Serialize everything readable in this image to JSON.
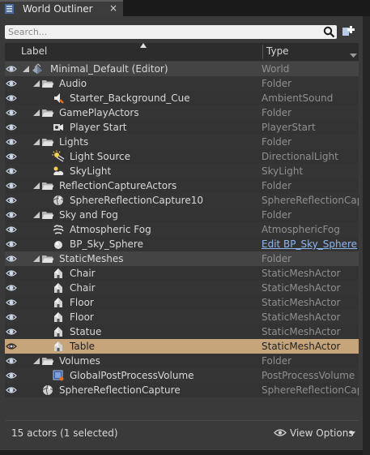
{
  "tab": {
    "title": "World Outliner",
    "close_label": "×"
  },
  "search": {
    "placeholder": "Search...",
    "value": ""
  },
  "columns": {
    "label": "Label",
    "type": "Type"
  },
  "rows": [
    {
      "label": "Minimal_Default (Editor)",
      "type": "World",
      "depth": 0,
      "icon": "world-icon",
      "expanded": true
    },
    {
      "label": "Audio",
      "type": "Folder",
      "depth": 1,
      "icon": "folder-open-icon",
      "expanded": true
    },
    {
      "label": "Starter_Background_Cue",
      "type": "AmbientSound",
      "depth": 2,
      "icon": "ambient-sound-icon"
    },
    {
      "label": "GamePlayActors",
      "type": "Folder",
      "depth": 1,
      "icon": "folder-open-icon",
      "expanded": true
    },
    {
      "label": "Player Start",
      "type": "PlayerStart",
      "depth": 2,
      "icon": "player-start-icon"
    },
    {
      "label": "Lights",
      "type": "Folder",
      "depth": 1,
      "icon": "folder-open-icon",
      "expanded": true
    },
    {
      "label": "Light Source",
      "type": "DirectionalLight",
      "depth": 2,
      "icon": "directional-light-icon"
    },
    {
      "label": "SkyLight",
      "type": "SkyLight",
      "depth": 2,
      "icon": "skylight-icon"
    },
    {
      "label": "ReflectionCaptureActors",
      "type": "Folder",
      "depth": 1,
      "icon": "folder-open-icon",
      "expanded": true
    },
    {
      "label": "SphereReflectionCapture10",
      "type": "SphereReflectionCaptu",
      "depth": 2,
      "icon": "sphere-reflection-capture-icon"
    },
    {
      "label": "Sky and Fog",
      "type": "Folder",
      "depth": 1,
      "icon": "folder-open-icon",
      "expanded": true
    },
    {
      "label": "Atmospheric Fog",
      "type": "AtmosphericFog",
      "depth": 2,
      "icon": "atmospheric-fog-icon"
    },
    {
      "label": "BP_Sky_Sphere",
      "type": "Edit BP_Sky_Sphere",
      "depth": 2,
      "icon": "sphere-icon",
      "type_is_link": true
    },
    {
      "label": "StaticMeshes",
      "type": "Folder",
      "depth": 1,
      "icon": "folder-open-icon",
      "expanded": true
    },
    {
      "label": "Chair",
      "type": "StaticMeshActor",
      "depth": 2,
      "icon": "static-mesh-icon"
    },
    {
      "label": "Chair",
      "type": "StaticMeshActor",
      "depth": 2,
      "icon": "static-mesh-icon"
    },
    {
      "label": "Floor",
      "type": "StaticMeshActor",
      "depth": 2,
      "icon": "static-mesh-icon"
    },
    {
      "label": "Floor",
      "type": "StaticMeshActor",
      "depth": 2,
      "icon": "static-mesh-icon"
    },
    {
      "label": "Statue",
      "type": "StaticMeshActor",
      "depth": 2,
      "icon": "static-mesh-icon"
    },
    {
      "label": "Table",
      "type": "StaticMeshActor",
      "depth": 2,
      "icon": "static-mesh-icon",
      "selected": true
    },
    {
      "label": "Volumes",
      "type": "Folder",
      "depth": 1,
      "icon": "folder-open-icon",
      "expanded": true
    },
    {
      "label": "GlobalPostProcessVolume",
      "type": "PostProcessVolume",
      "depth": 2,
      "icon": "post-process-volume-icon"
    },
    {
      "label": "SphereReflectionCapture",
      "type": "SphereReflectionCaptu",
      "depth": 1,
      "icon": "sphere-reflection-capture-icon"
    }
  ],
  "footer": {
    "status": "15 actors (1 selected)",
    "view_options_label": "View Options"
  },
  "colors": {
    "selected_row": "#c7a57b",
    "link": "#8fb8ef",
    "panel": "#3a3a3a"
  }
}
